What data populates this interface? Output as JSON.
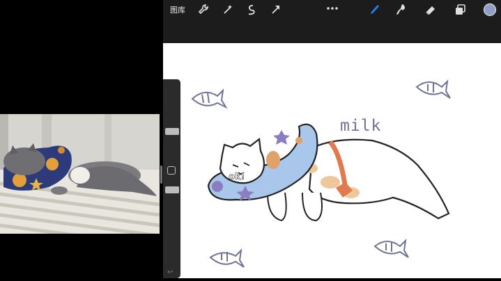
{
  "toolbar": {
    "gallery_label": "图库",
    "tools_left": [
      "wrench-icon",
      "magic-wand-icon",
      "selection-icon",
      "transform-arrow-icon"
    ],
    "tools_right": [
      "brush-icon",
      "smudge-icon",
      "eraser-icon",
      "layers-icon",
      "color-swatch"
    ],
    "more_icon": "more-icon",
    "active_tool": "brush",
    "accent_color": "#2f7df6",
    "color_swatch": "#8fa0c6"
  },
  "canvas": {
    "handwritten_text": "milk",
    "pillow_text": "ok!"
  },
  "reference_photo": {
    "subject": "cat-photo"
  }
}
